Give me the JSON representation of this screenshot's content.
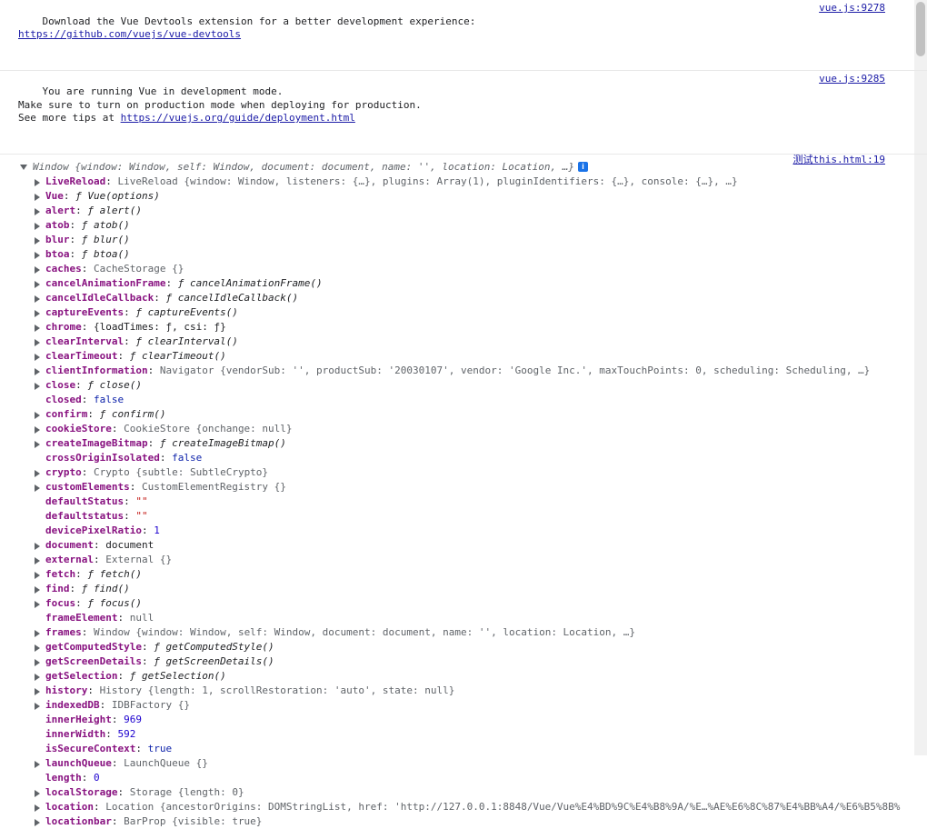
{
  "messages": [
    {
      "lines": [
        "Download the Vue Devtools extension for a better development experience:"
      ],
      "link": "https://github.com/vuejs/vue-devtools",
      "source": "vue.js:9278"
    },
    {
      "lines": [
        "You are running Vue in development mode.",
        "Make sure to turn on production mode when deploying for production.",
        "See more tips at "
      ],
      "link": "https://vuejs.org/guide/deployment.html",
      "source": "vue.js:9285"
    }
  ],
  "log_source": "测试this.html:19",
  "window_summary": "Window {window: Window, self: Window, document: document, name: '', location: Location, …}",
  "info_badge": "i",
  "props": [
    {
      "key": "LiveReload",
      "expand": true,
      "value": "LiveReload {window: Window, listeners: {…}, plugins: Array(1), pluginIdentifiers: {…}, console: {…}, …}",
      "kind": "type"
    },
    {
      "key": "Vue",
      "expand": true,
      "value": "ƒ Vue(options)",
      "kind": "fn"
    },
    {
      "key": "alert",
      "expand": true,
      "value": "ƒ alert()",
      "kind": "fn"
    },
    {
      "key": "atob",
      "expand": true,
      "value": "ƒ atob()",
      "kind": "fn"
    },
    {
      "key": "blur",
      "expand": true,
      "value": "ƒ blur()",
      "kind": "fn"
    },
    {
      "key": "btoa",
      "expand": true,
      "value": "ƒ btoa()",
      "kind": "fn"
    },
    {
      "key": "caches",
      "expand": true,
      "value": "CacheStorage {}",
      "kind": "type"
    },
    {
      "key": "cancelAnimationFrame",
      "expand": true,
      "value": "ƒ cancelAnimationFrame()",
      "kind": "fn"
    },
    {
      "key": "cancelIdleCallback",
      "expand": true,
      "value": "ƒ cancelIdleCallback()",
      "kind": "fn"
    },
    {
      "key": "captureEvents",
      "expand": true,
      "value": "ƒ captureEvents()",
      "kind": "fn"
    },
    {
      "key": "chrome",
      "expand": true,
      "value": "{loadTimes: ƒ, csi: ƒ}",
      "kind": "plain"
    },
    {
      "key": "clearInterval",
      "expand": true,
      "value": "ƒ clearInterval()",
      "kind": "fn"
    },
    {
      "key": "clearTimeout",
      "expand": true,
      "value": "ƒ clearTimeout()",
      "kind": "fn"
    },
    {
      "key": "clientInformation",
      "expand": true,
      "value": "Navigator {vendorSub: '', productSub: '20030107', vendor: 'Google Inc.', maxTouchPoints: 0, scheduling: Scheduling, …}",
      "kind": "type"
    },
    {
      "key": "close",
      "expand": true,
      "value": "ƒ close()",
      "kind": "fn"
    },
    {
      "key": "closed",
      "expand": false,
      "value": "false",
      "kind": "kw"
    },
    {
      "key": "confirm",
      "expand": true,
      "value": "ƒ confirm()",
      "kind": "fn"
    },
    {
      "key": "cookieStore",
      "expand": true,
      "value": "CookieStore {onchange: null}",
      "kind": "type"
    },
    {
      "key": "createImageBitmap",
      "expand": true,
      "value": "ƒ createImageBitmap()",
      "kind": "fn"
    },
    {
      "key": "crossOriginIsolated",
      "expand": false,
      "value": "false",
      "kind": "kw"
    },
    {
      "key": "crypto",
      "expand": true,
      "value": "Crypto {subtle: SubtleCrypto}",
      "kind": "type"
    },
    {
      "key": "customElements",
      "expand": true,
      "value": "CustomElementRegistry {}",
      "kind": "type"
    },
    {
      "key": "defaultStatus",
      "expand": false,
      "value": "\"\"",
      "kind": "str"
    },
    {
      "key": "defaultstatus",
      "expand": false,
      "value": "\"\"",
      "kind": "str"
    },
    {
      "key": "devicePixelRatio",
      "expand": false,
      "value": "1",
      "kind": "num"
    },
    {
      "key": "document",
      "expand": true,
      "value": "document",
      "kind": "plain"
    },
    {
      "key": "external",
      "expand": true,
      "value": "External {}",
      "kind": "type"
    },
    {
      "key": "fetch",
      "expand": true,
      "value": "ƒ fetch()",
      "kind": "fn"
    },
    {
      "key": "find",
      "expand": true,
      "value": "ƒ find()",
      "kind": "fn"
    },
    {
      "key": "focus",
      "expand": true,
      "value": "ƒ focus()",
      "kind": "fn"
    },
    {
      "key": "frameElement",
      "expand": false,
      "value": "null",
      "kind": "type"
    },
    {
      "key": "frames",
      "expand": true,
      "value": "Window {window: Window, self: Window, document: document, name: '', location: Location, …}",
      "kind": "type"
    },
    {
      "key": "getComputedStyle",
      "expand": true,
      "value": "ƒ getComputedStyle()",
      "kind": "fn"
    },
    {
      "key": "getScreenDetails",
      "expand": true,
      "value": "ƒ getScreenDetails()",
      "kind": "fn"
    },
    {
      "key": "getSelection",
      "expand": true,
      "value": "ƒ getSelection()",
      "kind": "fn"
    },
    {
      "key": "history",
      "expand": true,
      "value": "History {length: 1, scrollRestoration: 'auto', state: null}",
      "kind": "type"
    },
    {
      "key": "indexedDB",
      "expand": true,
      "value": "IDBFactory {}",
      "kind": "type"
    },
    {
      "key": "innerHeight",
      "expand": false,
      "value": "969",
      "kind": "num"
    },
    {
      "key": "innerWidth",
      "expand": false,
      "value": "592",
      "kind": "num"
    },
    {
      "key": "isSecureContext",
      "expand": false,
      "value": "true",
      "kind": "kw"
    },
    {
      "key": "launchQueue",
      "expand": true,
      "value": "LaunchQueue {}",
      "kind": "type"
    },
    {
      "key": "length",
      "expand": false,
      "value": "0",
      "kind": "num"
    },
    {
      "key": "localStorage",
      "expand": true,
      "value": "Storage {length: 0}",
      "kind": "type"
    },
    {
      "key": "location",
      "expand": true,
      "value": "Location {ancestorOrigins: DOMStringList, href: 'http://127.0.0.1:8848/Vue/Vue%E4%BD%9C%E4%B8%9A/%E…%AE%E6%8C%87%E4%BB%A4/%E6%B5%8B%",
      "kind": "type"
    },
    {
      "key": "locationbar",
      "expand": true,
      "value": "BarProp {visible: true}",
      "kind": "type"
    }
  ]
}
